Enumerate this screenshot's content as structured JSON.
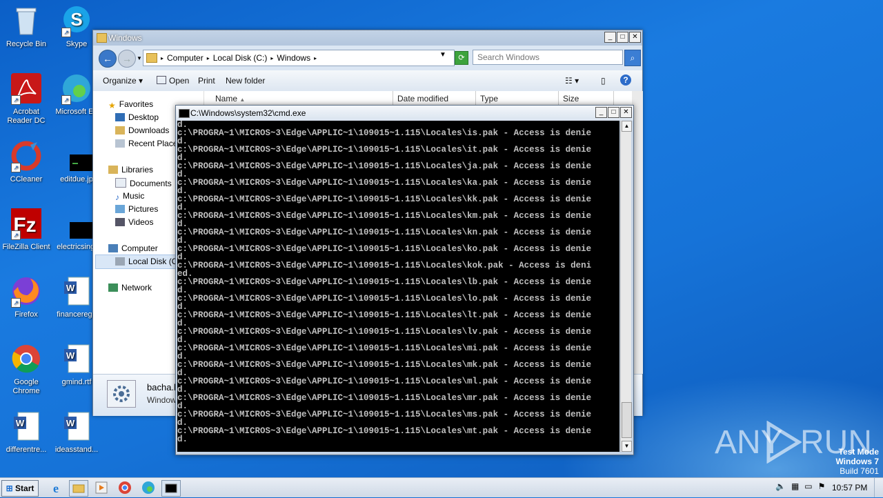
{
  "desktop": {
    "icons": [
      {
        "label": "Recycle Bin"
      },
      {
        "label": "Skype"
      },
      {
        "label": "Acrobat Reader DC"
      },
      {
        "label": "Microsoft Ed"
      },
      {
        "label": "CCleaner"
      },
      {
        "label": "editdue.jp"
      },
      {
        "label": "FileZilla Client"
      },
      {
        "label": "electricsingl"
      },
      {
        "label": "Firefox"
      },
      {
        "label": "financerega"
      },
      {
        "label": "Google Chrome"
      },
      {
        "label": "gmind.rtf"
      },
      {
        "label": "differentre..."
      },
      {
        "label": "ideasstand..."
      }
    ]
  },
  "explorer": {
    "title": "Windows",
    "address": {
      "crumbs": [
        "Computer",
        "Local Disk (C:)",
        "Windows"
      ]
    },
    "search_placeholder": "Search Windows",
    "toolbar": {
      "organize": "Organize",
      "open": "Open",
      "print": "Print",
      "new_folder": "New folder"
    },
    "columns": [
      "Name",
      "Date modified",
      "Type",
      "Size"
    ],
    "nav": {
      "favorites": "Favorites",
      "desktop": "Desktop",
      "downloads": "Downloads",
      "recent": "Recent Places",
      "libraries": "Libraries",
      "documents": "Documents",
      "music": "Music",
      "pictures": "Pictures",
      "videos": "Videos",
      "computer": "Computer",
      "local_disk": "Local Disk (C:",
      "network": "Network"
    },
    "details": {
      "name": "bacha.l",
      "type": "Window"
    }
  },
  "cmd": {
    "title": "C:\\Windows\\system32\\cmd.exe",
    "lines": [
      "d.",
      "c:\\PROGRA~1\\MICROS~3\\Edge\\APPLIC~1\\109015~1.115\\Locales\\is.pak - Access is denie",
      "d.",
      "c:\\PROGRA~1\\MICROS~3\\Edge\\APPLIC~1\\109015~1.115\\Locales\\it.pak - Access is denie",
      "d.",
      "c:\\PROGRA~1\\MICROS~3\\Edge\\APPLIC~1\\109015~1.115\\Locales\\ja.pak - Access is denie",
      "d.",
      "c:\\PROGRA~1\\MICROS~3\\Edge\\APPLIC~1\\109015~1.115\\Locales\\ka.pak - Access is denie",
      "d.",
      "c:\\PROGRA~1\\MICROS~3\\Edge\\APPLIC~1\\109015~1.115\\Locales\\kk.pak - Access is denie",
      "d.",
      "c:\\PROGRA~1\\MICROS~3\\Edge\\APPLIC~1\\109015~1.115\\Locales\\km.pak - Access is denie",
      "d.",
      "c:\\PROGRA~1\\MICROS~3\\Edge\\APPLIC~1\\109015~1.115\\Locales\\kn.pak - Access is denie",
      "d.",
      "c:\\PROGRA~1\\MICROS~3\\Edge\\APPLIC~1\\109015~1.115\\Locales\\ko.pak - Access is denie",
      "d.",
      "c:\\PROGRA~1\\MICROS~3\\Edge\\APPLIC~1\\109015~1.115\\Locales\\kok.pak - Access is deni",
      "ed.",
      "c:\\PROGRA~1\\MICROS~3\\Edge\\APPLIC~1\\109015~1.115\\Locales\\lb.pak - Access is denie",
      "d.",
      "c:\\PROGRA~1\\MICROS~3\\Edge\\APPLIC~1\\109015~1.115\\Locales\\lo.pak - Access is denie",
      "d.",
      "c:\\PROGRA~1\\MICROS~3\\Edge\\APPLIC~1\\109015~1.115\\Locales\\lt.pak - Access is denie",
      "d.",
      "c:\\PROGRA~1\\MICROS~3\\Edge\\APPLIC~1\\109015~1.115\\Locales\\lv.pak - Access is denie",
      "d.",
      "c:\\PROGRA~1\\MICROS~3\\Edge\\APPLIC~1\\109015~1.115\\Locales\\mi.pak - Access is denie",
      "d.",
      "c:\\PROGRA~1\\MICROS~3\\Edge\\APPLIC~1\\109015~1.115\\Locales\\mk.pak - Access is denie",
      "d.",
      "c:\\PROGRA~1\\MICROS~3\\Edge\\APPLIC~1\\109015~1.115\\Locales\\ml.pak - Access is denie",
      "d.",
      "c:\\PROGRA~1\\MICROS~3\\Edge\\APPLIC~1\\109015~1.115\\Locales\\mr.pak - Access is denie",
      "d.",
      "c:\\PROGRA~1\\MICROS~3\\Edge\\APPLIC~1\\109015~1.115\\Locales\\ms.pak - Access is denie",
      "d.",
      "c:\\PROGRA~1\\MICROS~3\\Edge\\APPLIC~1\\109015~1.115\\Locales\\mt.pak - Access is denie",
      "d."
    ]
  },
  "taskbar": {
    "start": "Start",
    "clock": "10:57 PM"
  },
  "watermark": {
    "brand_left": "ANY",
    "brand_right": "RUN"
  },
  "os_notice": {
    "line1": "Test Mode",
    "line2": "Windows 7",
    "line3": "Build 7601"
  }
}
